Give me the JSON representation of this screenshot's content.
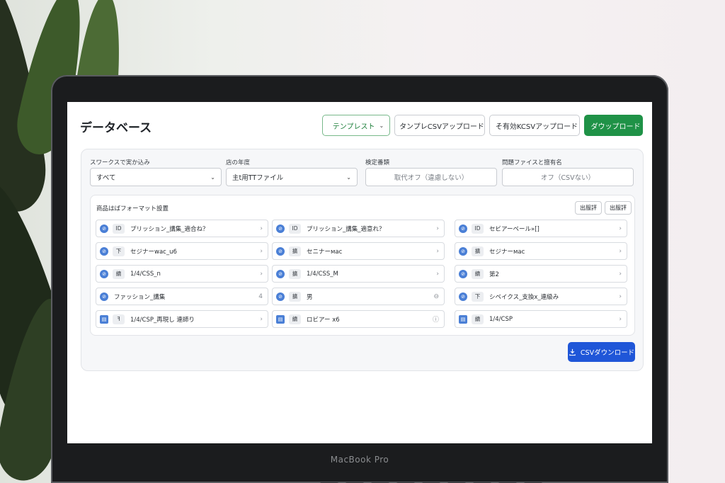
{
  "header": {
    "title": "データベース",
    "buttons": {
      "template": "テンプレスト",
      "template_upload": "タンプレCSVアップロード",
      "other_upload": "そ有効KCSVアップロード",
      "download": "ダウップロード"
    }
  },
  "filters": [
    {
      "label": "スワークスで実か込み",
      "value": "すべて",
      "type": "select"
    },
    {
      "label": "店の年度",
      "value": "主t用TTファイル",
      "type": "select"
    },
    {
      "label": "検定番類",
      "value": "取代オフ（違慮しない）",
      "type": "input"
    },
    {
      "label": "問題ファイスと擅有名",
      "value": "オフ（CSVない）",
      "type": "input"
    }
  ],
  "format_section": {
    "title": "商品はばフォーマット設置",
    "buttons": [
      "出服評",
      "出服評"
    ],
    "fields": [
      {
        "tag": "ID",
        "name": "プリッション_講集_適合ね？",
        "end": "›",
        "icon": "link"
      },
      {
        "tag": "ID",
        "name": "プリッション_講集_適意れ？",
        "end": "›",
        "icon": "link"
      },
      {
        "tag": "ID",
        "name": "セビアーベール»[]",
        "end": "›",
        "icon": "link"
      },
      {
        "tag": "下",
        "name": "セジナーwac_u6",
        "end": "›",
        "icon": "link"
      },
      {
        "tag": "擴",
        "name": "セニナーмac",
        "end": "›",
        "icon": "link"
      },
      {
        "tag": "擴",
        "name": "セジナーмac",
        "end": "›",
        "icon": "link"
      },
      {
        "tag": "續",
        "name": "1/4/CSS_n",
        "end": "›",
        "icon": "link"
      },
      {
        "tag": "擴",
        "name": "1/4/CSS_M",
        "end": "›",
        "icon": "link"
      },
      {
        "tag": "續",
        "name": "第2",
        "end": "›",
        "icon": "link"
      },
      {
        "tag": "",
        "name": "ファッション_講集",
        "end": "4",
        "icon": "link"
      },
      {
        "tag": "擴",
        "name": "男",
        "end": "⊖",
        "icon": "link"
      },
      {
        "tag": "下",
        "name": "シベイクス_支換x_連級み",
        "end": "›",
        "icon": "link"
      },
      {
        "tag": "ꟻ",
        "name": "1/4/CSP_再現し 連師り",
        "end": "›",
        "icon": "doc"
      },
      {
        "tag": "續",
        "name": "ロビアー x6",
        "end": "ⓘ",
        "icon": "doc"
      },
      {
        "tag": "續",
        "name": "1/4/CSP",
        "end": "›",
        "icon": "doc"
      }
    ]
  },
  "csv_download": "CSVダウンロード",
  "laptop_label": "MacBook Pro",
  "colors": {
    "primary_green": "#1f9247",
    "primary_blue": "#1f56d8",
    "icon_blue": "#4a7fd6"
  }
}
